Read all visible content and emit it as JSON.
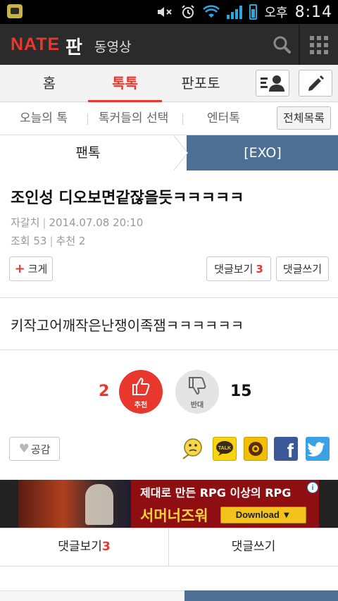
{
  "status_bar": {
    "app_icon": "kakaotalk-icon",
    "icons": [
      "mute-icon",
      "alarm-icon",
      "wifi-icon",
      "signal-icon",
      "battery-icon"
    ],
    "ampm": "오후",
    "time": "8:14"
  },
  "app_bar": {
    "logo": "NATE",
    "logo_pan": "판",
    "video_label": "동영상",
    "search_icon": "search-icon",
    "menu_icon": "grid-menu-icon",
    "colors": {
      "brand_red": "#e8372c",
      "bar_bg": "#2b2b2b"
    }
  },
  "tabs": {
    "home": "홈",
    "toktok": "톡톡",
    "photo": "판포토",
    "active": "톡톡",
    "profile_icon": "profile-list-icon",
    "write_icon": "pencil-icon"
  },
  "subtabs": {
    "today": "오늘의 톡",
    "choice": "톡커들의 선택",
    "enter": "엔터톡",
    "all": "전체목록"
  },
  "category": {
    "left": "팬톡",
    "right": "[EXO]",
    "accent": "#4d6f94"
  },
  "post": {
    "title": "조인성 디오보면같잖을듯ㅋㅋㅋㅋㅋ",
    "author": "자갈치",
    "date": "2014.07.08 20:10",
    "views": "조회 53",
    "recommend": "추천 2",
    "zoom_label": "크게",
    "comments_label": "댓글보기",
    "comments_count": "3",
    "write_comment_label": "댓글쓰기",
    "body": "키작고어깨작은난쟁이족잼ㅋㅋㅋㅋㅋㅋ"
  },
  "vote": {
    "up_count": "2",
    "up_label": "추천",
    "down_label": "반대",
    "down_count": "15"
  },
  "share": {
    "like_label": "공감",
    "icons": [
      "emoticon-icon",
      "kakaotalk-share-icon",
      "kakaostory-share-icon",
      "facebook-icon",
      "twitter-icon"
    ],
    "talk_text": "TALK",
    "fb_text": "f"
  },
  "ad": {
    "line1": "제대로 만든 RPG 이상의 RPG",
    "line2": "서머너즈워",
    "button": "Download",
    "info": "i"
  },
  "bottom_bar": {
    "comments_label": "댓글보기",
    "comments_count": "3",
    "write_label": "댓글쓰기"
  }
}
